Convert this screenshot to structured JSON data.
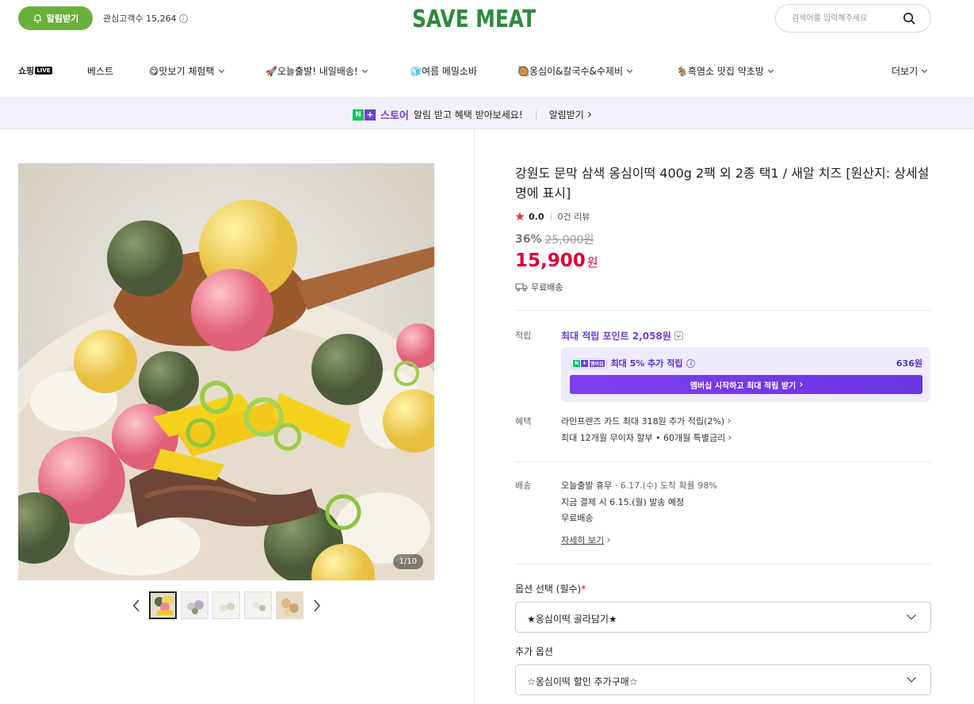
{
  "header": {
    "notify_label": "알림받기",
    "followers_label": "관심고객수 15,264",
    "logo_text": "SAVE MEAT",
    "search_placeholder": "검색어를 입력해주세요"
  },
  "nav": {
    "items": [
      {
        "label": "쇼핑"
      },
      {
        "label": "LIVE"
      },
      {
        "label": "베스트"
      },
      {
        "label": "😋맛보기 체험팩"
      },
      {
        "label": "🚀오늘출발! 내일배송!"
      },
      {
        "label": "🧊여름 메밀소바"
      },
      {
        "label": "🥘옹심이&칼국수&수제비"
      },
      {
        "label": "🐐흑염소 맛집 약초방"
      },
      {
        "label": "더보기"
      }
    ]
  },
  "store_banner": {
    "n_mark": "N",
    "plus_mark": "+",
    "store_label": "스토어",
    "message": "알림 받고 혜택 받아보세요!",
    "cta": "알림받기"
  },
  "gallery": {
    "counter": "1/10",
    "thumbnails": 5
  },
  "product": {
    "title": "강원도 문막 삼색 옹심이떡 400g 2팩 외 2종 택1 / 새알 치즈 [원산지: 상세설명에 표시]",
    "rating": "0.0",
    "reviews": "0건 리뷰",
    "discount_pct": "36%",
    "original_price": "25,000원",
    "price": "15,900",
    "price_unit": "원",
    "shipping_free": "무료배송"
  },
  "points": {
    "label": "적립",
    "max_points": "최대 적립 포인트 2,058원",
    "member_tag": "멤버십",
    "member_line": "최대 5% 추가 적립",
    "member_points": "636원",
    "member_cta": "멤버십 시작하고 최대 적립 받기"
  },
  "benefits": {
    "label": "혜택",
    "line1": "라인프렌즈 카드 최대 318원 추가 적립(2%)",
    "line2": "최대 12개월 무이자 할부 • 60개월 특별금리"
  },
  "delivery": {
    "label": "배송",
    "line1_strong": "오늘출발 휴무",
    "line1_rest": " · 6.17.(수) 도착 확률 98%",
    "line2": "지금 결제 시 6.15.(월) 발송 예정",
    "line3": "무료배송",
    "detail_link": "자세히 보기"
  },
  "options": {
    "required_label": "옵션 선택 (필수)",
    "required_mark": "*",
    "required_value": "★옹심이떡 골라담기★",
    "extra_label": "추가 옵션",
    "extra_value": "☆옹심이떡 할인 추가구매☆"
  },
  "colors": {
    "brand_green": "#6ab03a",
    "price_red": "#d60036",
    "naver_purple": "#6b3fd6",
    "naver_green": "#03c75a"
  }
}
